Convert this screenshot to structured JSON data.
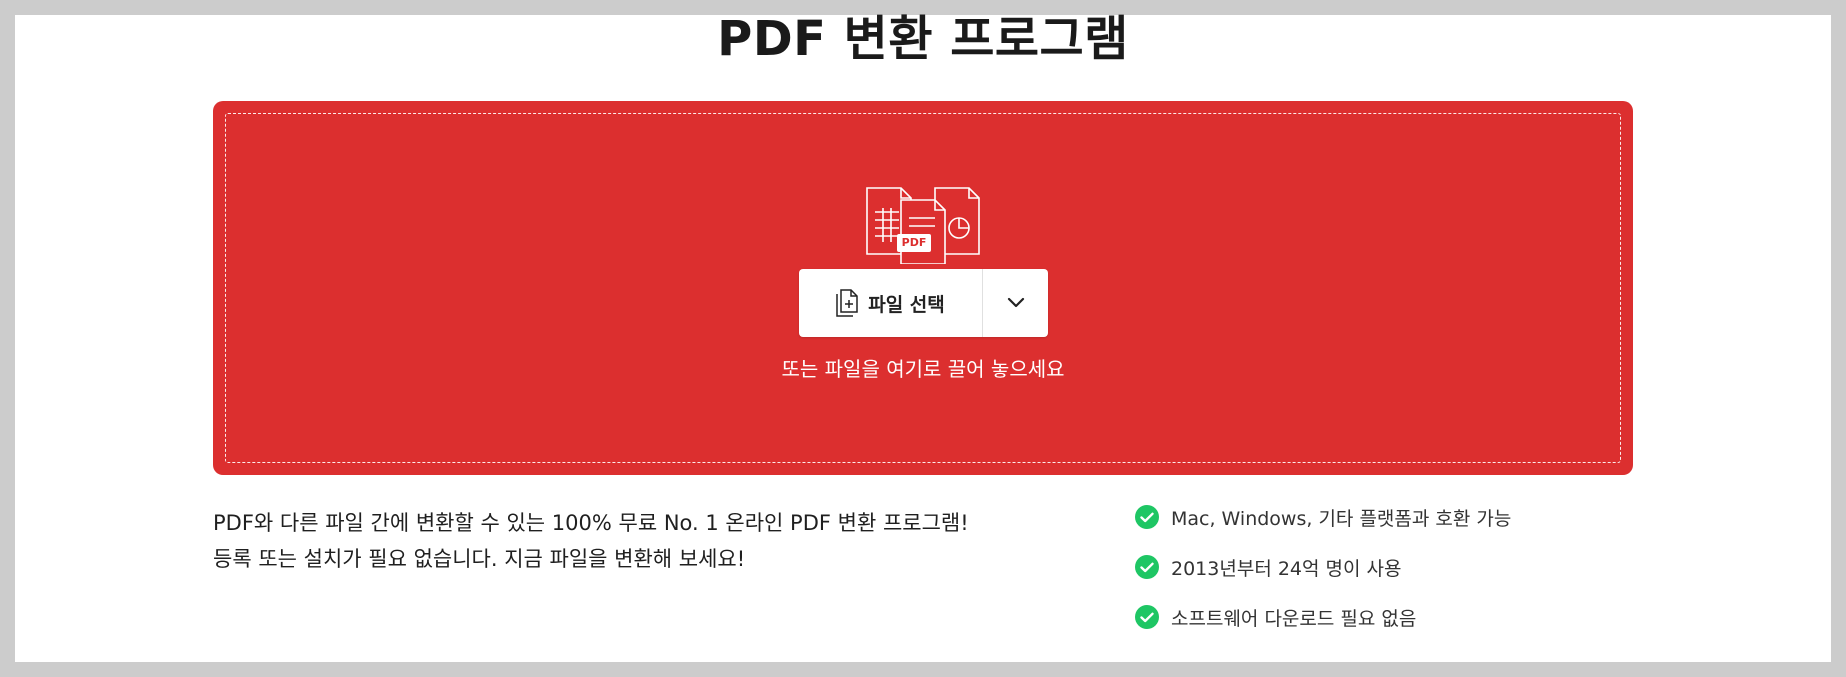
{
  "header": {
    "title": "PDF 변환 프로그램"
  },
  "dropzone": {
    "illustration_icon": "documents-to-pdf-icon",
    "illustration_label": "PDF",
    "choose_file_label": "파일 선택",
    "choose_file_icon": "file-add-icon",
    "dropdown_icon": "chevron-down-icon",
    "drop_hint": "또는 파일을 여기로 끌어 놓으세요",
    "background_color": "#dc2f2f"
  },
  "description": {
    "line1": "PDF와 다른 파일 간에 변환할 수 있는 100% 무료 No. 1 온라인 PDF 변환 프로그램!",
    "line2": "등록 또는 설치가 필요 없습니다. 지금 파일을 변환해 보세요!"
  },
  "features": [
    {
      "text": "Mac, Windows, 기타 플랫폼과 호환 가능",
      "icon": "check-circle-icon"
    },
    {
      "text": "2013년부터 24억 명이 사용",
      "icon": "check-circle-icon"
    },
    {
      "text": "소프트웨어 다운로드 필요 없음",
      "icon": "check-circle-icon"
    }
  ],
  "colors": {
    "accent": "#dc2f2f",
    "check": "#1ec664"
  }
}
